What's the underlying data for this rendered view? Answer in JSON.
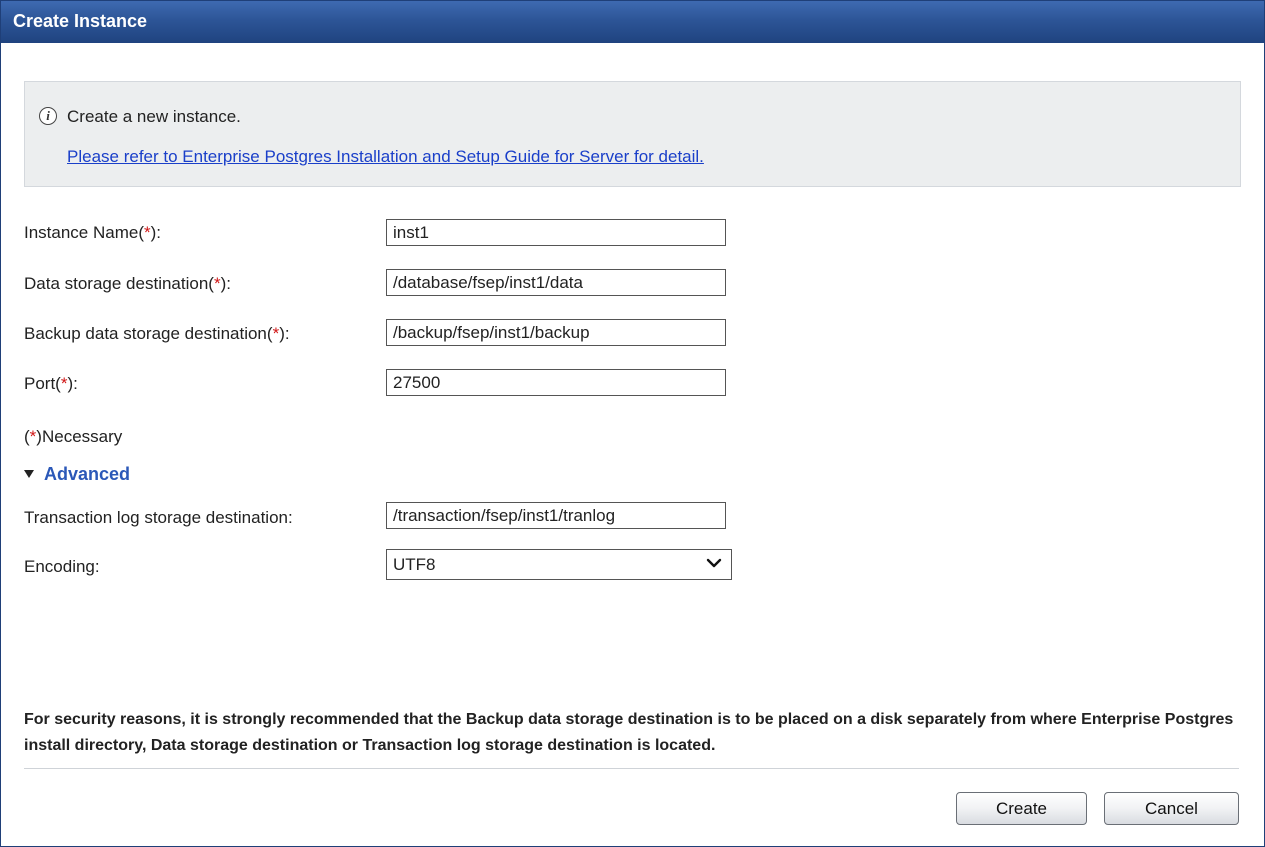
{
  "dialog": {
    "title": "Create Instance"
  },
  "info": {
    "icon": "info-icon",
    "message": "Create a new instance.",
    "link_text": "Please refer to Enterprise Postgres Installation and Setup Guide for Server for detail."
  },
  "required_marker": "*",
  "fields": [
    {
      "label_before": "Instance Name(",
      "label_after": "):",
      "value": "inst1"
    },
    {
      "label_before": "Data storage destination(",
      "label_after": "):",
      "value": "/database/fsep/inst1/data"
    },
    {
      "label_before": "Backup data storage destination(",
      "label_after": "):",
      "value": "/backup/fsep/inst1/backup"
    },
    {
      "label_before": "Port(",
      "label_after": "):",
      "value": "27500"
    }
  ],
  "necessary_note": {
    "before": "(",
    "after": ")Necessary"
  },
  "advanced": {
    "label": "Advanced",
    "expanded": true,
    "transaction_log": {
      "label": "Transaction log storage destination:",
      "value": "/transaction/fsep/inst1/tranlog"
    },
    "encoding": {
      "label": "Encoding:",
      "selected": "UTF8"
    }
  },
  "warning": "For security reasons, it is strongly recommended that the Backup data storage destination is to be placed on a disk separately from where Enterprise Postgres install directory, Data storage destination or Transaction log storage destination is located.",
  "buttons": {
    "create": "Create",
    "cancel": "Cancel"
  },
  "colors": {
    "titlebar": "#2d5597",
    "required": "#d01515",
    "link": "#1a3fc9",
    "advanced": "#2b58b8"
  }
}
